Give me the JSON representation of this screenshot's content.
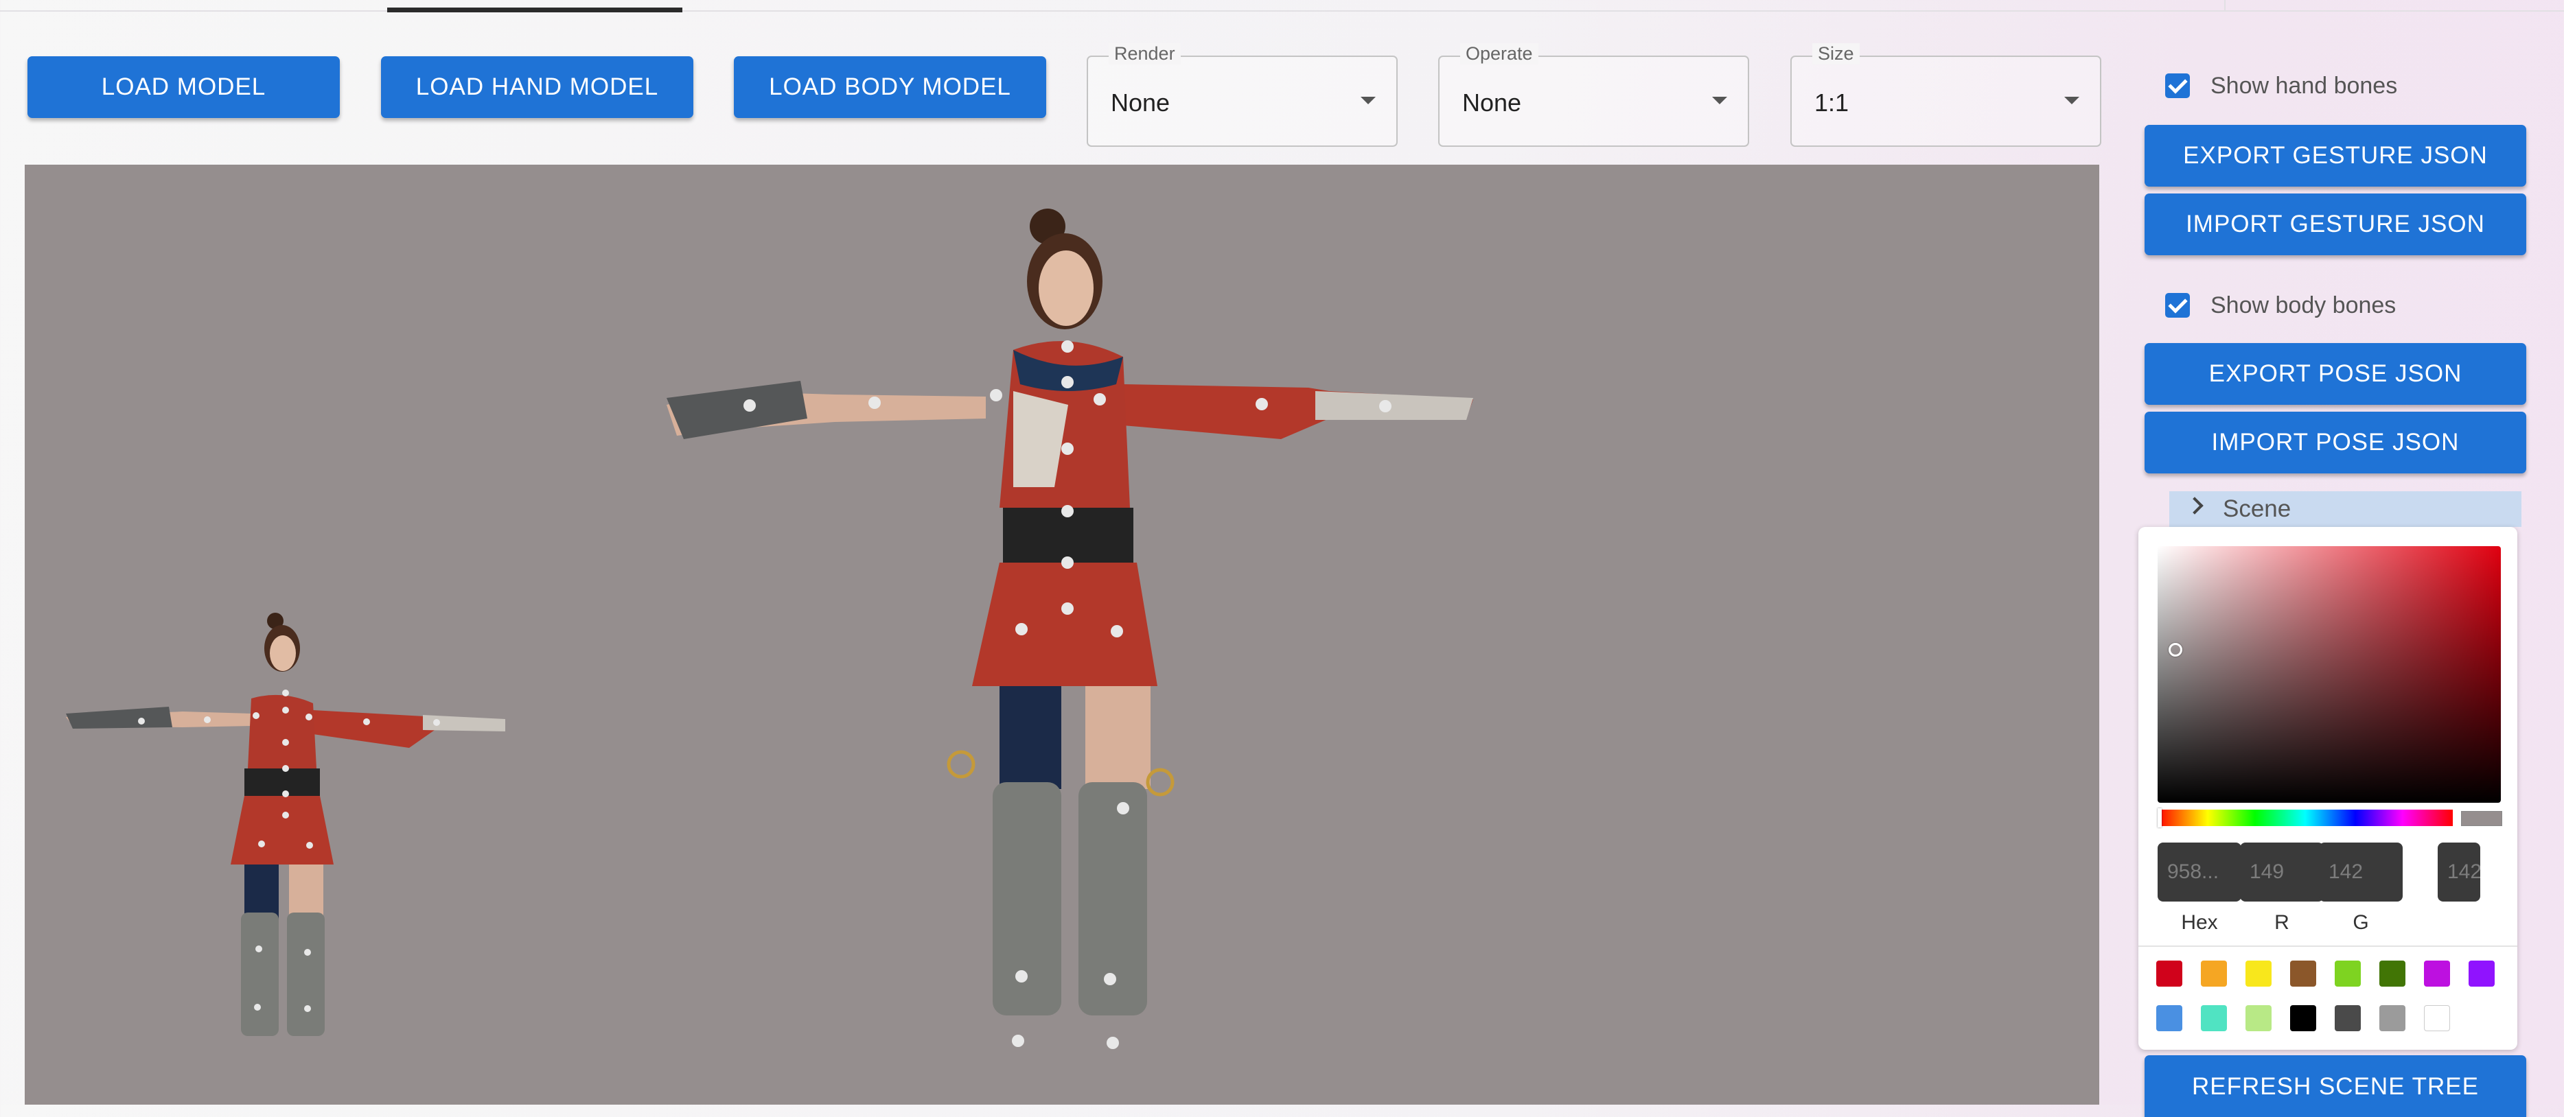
{
  "toolbar": {
    "load_model": "LOAD MODEL",
    "load_hand_model": "LOAD HAND MODEL",
    "load_body_model": "LOAD BODY MODEL"
  },
  "selects": {
    "render": {
      "label": "Render",
      "value": "None"
    },
    "operate": {
      "label": "Operate",
      "value": "None"
    },
    "size": {
      "label": "Size",
      "value": "1:1"
    }
  },
  "panel": {
    "show_hand_bones": "Show hand bones",
    "export_gesture": "EXPORT GESTURE JSON",
    "import_gesture": "IMPORT GESTURE JSON",
    "show_body_bones": "Show body bones",
    "export_pose": "EXPORT POSE JSON",
    "import_pose": "IMPORT POSE JSON",
    "scene_label": "Scene",
    "refresh_scene_tree": "REFRESH SCENE TREE"
  },
  "color_picker": {
    "hex_value": "958...",
    "r_value": "149",
    "g_value": "142",
    "b_value": "142",
    "labels": {
      "hex": "Hex",
      "r": "R",
      "g": "G"
    },
    "current_color": "#958e8e",
    "swatches": [
      "#d0021b",
      "#f5a623",
      "#f8e71c",
      "#8b572a",
      "#7ed321",
      "#417505",
      "#bd10e0",
      "#9013fe",
      "#4a90e2",
      "#50e3c2",
      "#b8e986",
      "#000000",
      "#4a4a4a",
      "#9b9b9b",
      "#ffffff"
    ]
  },
  "colors": {
    "accent": "#1f73d6",
    "viewport_bg": "#958e8e"
  }
}
